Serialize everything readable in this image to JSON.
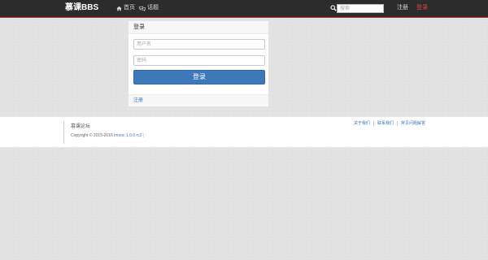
{
  "nav": {
    "brand": "慕课BBS",
    "home_label": "首页",
    "topics_label": "话题",
    "search_placeholder": "搜索",
    "register_label": "注册",
    "login_label": "登录"
  },
  "login_panel": {
    "title": "登录",
    "username_placeholder": "用户名",
    "password_placeholder": "密码",
    "submit_label": "登录",
    "register_link": "注册"
  },
  "footer": {
    "title": "慕课论坛",
    "copyright": "Copyright © 2015-2016",
    "version": "imooc 1.0.0 rc2",
    "separator": "| :",
    "links": [
      "关于我们",
      "联系我们",
      "常见问题解答"
    ]
  },
  "colors": {
    "navbar": "#2c2c2c",
    "accent_red": "#c8312a",
    "primary_blue": "#3d79b8",
    "background": "#e2e2e2"
  }
}
